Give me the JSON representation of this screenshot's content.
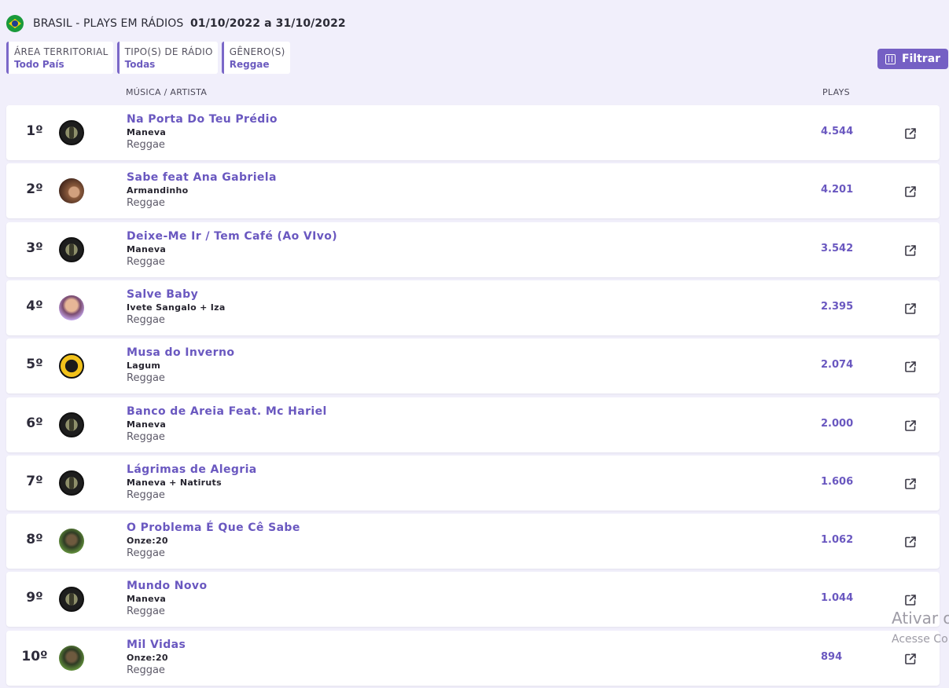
{
  "header": {
    "title": "BRASIL - PLAYS EM RÁDIOS",
    "dates": "01/10/2022 a 31/10/2022"
  },
  "filters": [
    {
      "label": "ÁREA TERRITORIAL",
      "value": "Todo País"
    },
    {
      "label": "TIPO(S) DE RÁDIO",
      "value": "Todas"
    },
    {
      "label": "GÊNERO(S)",
      "value": "Reggae"
    }
  ],
  "filter_button": {
    "label": "Filtrar",
    "color": "#7560c4"
  },
  "columns": {
    "music_artist": "MÚSICA / ARTISTA",
    "plays": "PLAYS"
  },
  "accent_color": "#6a58c0",
  "rows": [
    {
      "rank": "1º",
      "song": "Na Porta Do Teu Prédio",
      "artist": "Maneva",
      "genre": "Reggae",
      "plays": "4.544",
      "avatar": "maneva"
    },
    {
      "rank": "2º",
      "song": "Sabe feat Ana Gabriela",
      "artist": "Armandinho",
      "genre": "Reggae",
      "plays": "4.201",
      "avatar": "armandinho"
    },
    {
      "rank": "3º",
      "song": "Deixe-Me Ir / Tem Café (Ao VIvo)",
      "artist": "Maneva",
      "genre": "Reggae",
      "plays": "3.542",
      "avatar": "maneva"
    },
    {
      "rank": "4º",
      "song": "Salve Baby",
      "artist": "Ivete Sangalo + Iza",
      "genre": "Reggae",
      "plays": "2.395",
      "avatar": "ivete"
    },
    {
      "rank": "5º",
      "song": "Musa do Inverno",
      "artist": "Lagum",
      "genre": "Reggae",
      "plays": "2.074",
      "avatar": "lagum"
    },
    {
      "rank": "6º",
      "song": "Banco de Areia Feat. Mc Hariel",
      "artist": "Maneva",
      "genre": "Reggae",
      "plays": "2.000",
      "avatar": "maneva"
    },
    {
      "rank": "7º",
      "song": "Lágrimas de Alegria",
      "artist": "Maneva + Natiruts",
      "genre": "Reggae",
      "plays": "1.606",
      "avatar": "maneva"
    },
    {
      "rank": "8º",
      "song": "O Problema É Que Cê Sabe",
      "artist": "Onze:20",
      "genre": "Reggae",
      "plays": "1.062",
      "avatar": "onze"
    },
    {
      "rank": "9º",
      "song": "Mundo Novo",
      "artist": "Maneva",
      "genre": "Reggae",
      "plays": "1.044",
      "avatar": "maneva"
    },
    {
      "rank": "10º",
      "song": "Mil Vidas",
      "artist": "Onze:20",
      "genre": "Reggae",
      "plays": "894",
      "avatar": "onze"
    }
  ],
  "watermark": {
    "title": "Ativar o",
    "subtitle": "Acesse Co"
  }
}
